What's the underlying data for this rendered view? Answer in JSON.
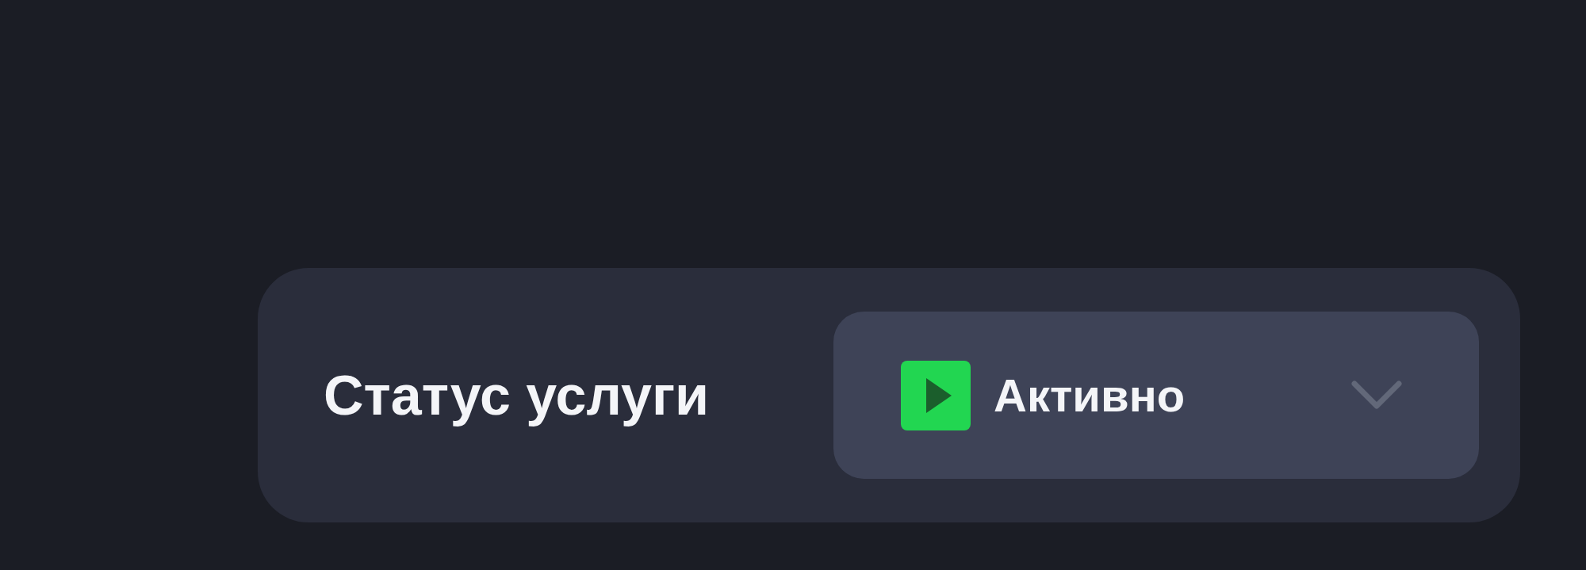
{
  "service_status": {
    "label": "Статус услуги",
    "dropdown": {
      "value": "Активно",
      "active": true,
      "expanded": false
    }
  }
}
